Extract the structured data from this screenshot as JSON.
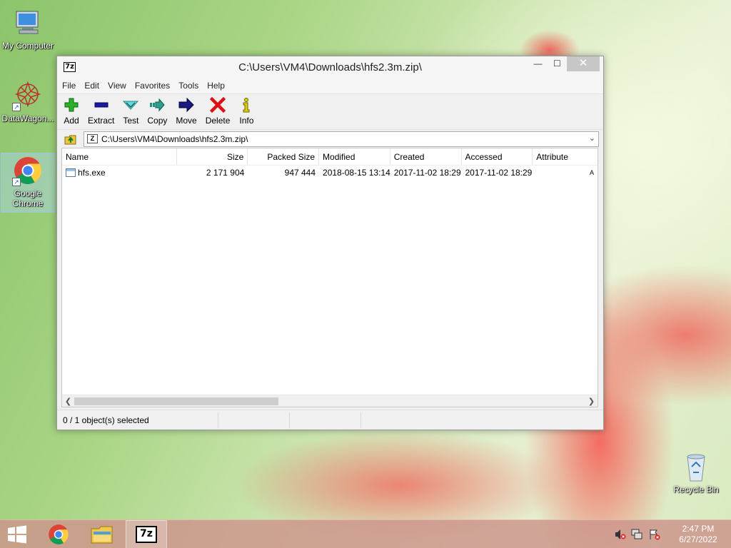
{
  "desktop": {
    "icons": [
      {
        "label": "My Computer",
        "icon": "computer-icon"
      },
      {
        "label": "DataWagon...",
        "icon": "datawagon-icon"
      },
      {
        "label": "Google Chrome",
        "icon": "chrome-icon"
      },
      {
        "label": "Recycle Bin",
        "icon": "recycle-bin-icon"
      }
    ]
  },
  "window": {
    "app_icon_text": "7z",
    "title": "C:\\Users\\VM4\\Downloads\\hfs2.3m.zip\\",
    "minimize": "—",
    "maximize": "☐",
    "close": "✕",
    "menu": [
      "File",
      "Edit",
      "View",
      "Favorites",
      "Tools",
      "Help"
    ],
    "toolbar": [
      {
        "label": "Add",
        "icon": "add-icon",
        "color": "#22aa22"
      },
      {
        "label": "Extract",
        "icon": "extract-icon",
        "color": "#1a1aa0"
      },
      {
        "label": "Test",
        "icon": "test-icon",
        "color": "#20b0b0"
      },
      {
        "label": "Copy",
        "icon": "copy-icon",
        "color": "#1f8f7f"
      },
      {
        "label": "Move",
        "icon": "move-icon",
        "color": "#1a1a80"
      },
      {
        "label": "Delete",
        "icon": "delete-icon",
        "color": "#dd1111"
      },
      {
        "label": "Info",
        "icon": "info-icon",
        "color": "#d8c800"
      }
    ],
    "address": "C:\\Users\\VM4\\Downloads\\hfs2.3m.zip\\",
    "columns": [
      "Name",
      "Size",
      "Packed Size",
      "Modified",
      "Created",
      "Accessed",
      "Attribute"
    ],
    "rows": [
      {
        "name": "hfs.exe",
        "size": "2 171 904",
        "packed": "947 444",
        "modified": "2018-08-15 13:14",
        "created": "2017-11-02 18:29",
        "accessed": "2017-11-02 18:29",
        "attr": "A"
      }
    ],
    "status": "0 / 1 object(s) selected"
  },
  "taskbar": {
    "items": [
      "start-icon",
      "chrome-icon",
      "file-explorer-icon",
      "7zip-icon"
    ],
    "time": "2:47 PM",
    "date": "6/27/2022"
  }
}
